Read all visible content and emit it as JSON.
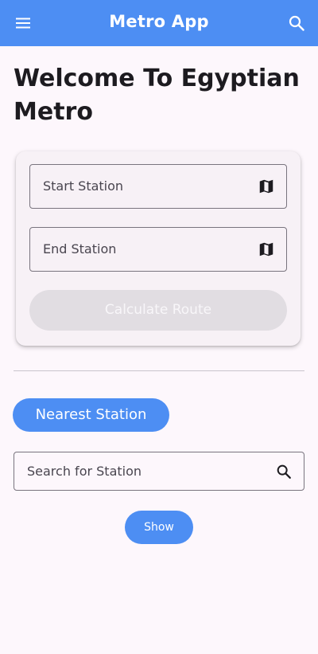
{
  "app_bar": {
    "title": "Metro App",
    "menu_icon": "menu-icon",
    "search_icon": "search-icon"
  },
  "welcome": {
    "heading": "Welcome To Egyptian Metro"
  },
  "route_card": {
    "start_station_label": "Start Station",
    "end_station_label": "End Station",
    "field_icon": "map-icon",
    "calculate_label": "Calculate Route",
    "calculate_enabled": false
  },
  "nearest_station_label": "Nearest Station",
  "search": {
    "placeholder": "Search for Station",
    "icon": "search-icon"
  },
  "show_label": "Show",
  "colors": {
    "primary": "#4d8ef3",
    "background": "#fdf7fc",
    "card": "#f7f1f6",
    "disabled_button": "#e1dde2",
    "outline": "#79747e"
  }
}
